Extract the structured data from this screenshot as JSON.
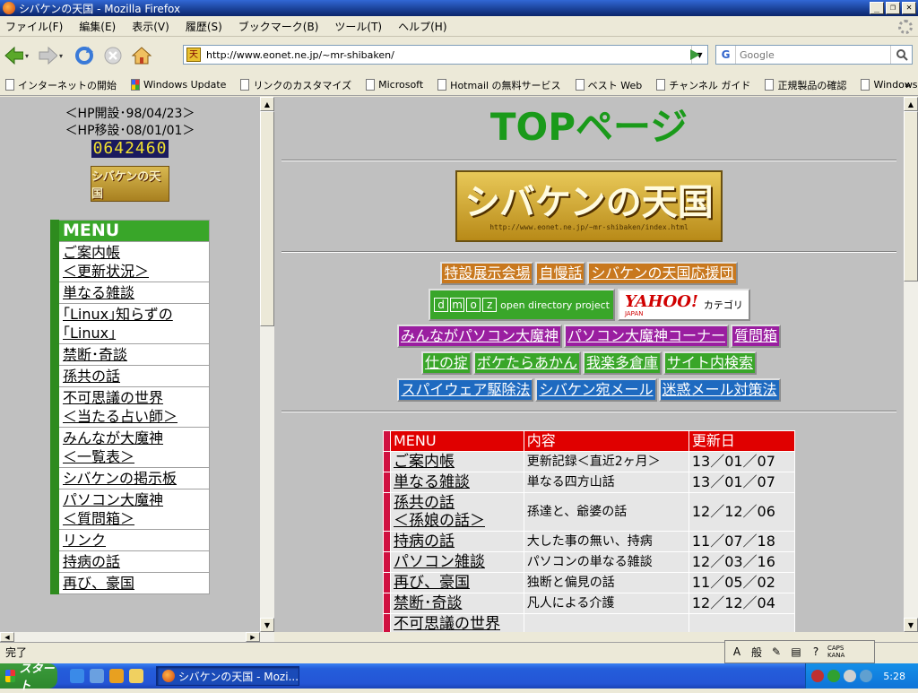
{
  "window": {
    "title": "シバケンの天国 - Mozilla Firefox"
  },
  "menubar": [
    "ファイル(F)",
    "編集(E)",
    "表示(V)",
    "履歴(S)",
    "ブックマーク(B)",
    "ツール(T)",
    "ヘルプ(H)"
  ],
  "nav": {
    "url": "http://www.eonet.ne.jp/~mr-shibaken/",
    "site_favicon": "天",
    "search_placeholder": "Google",
    "search_engine_icon": "G"
  },
  "bookmarks": [
    "インターネットの開始",
    "Windows Update",
    "リンクのカスタマイズ",
    "Microsoft",
    "Hotmail の無料サービス",
    "ベスト Web",
    "チャンネル ガイド",
    "正規製品の確認",
    "Windows"
  ],
  "bookmarks_more": "»",
  "left": {
    "hp_open": "＜HP開設･98/04/23＞",
    "hp_move": "＜HP移設･08/01/01＞",
    "counter": "0642460",
    "small_logo": "シバケンの天国",
    "menu_title": "MENU",
    "menu_items": [
      "ご案内帳\n＜更新状況＞",
      "単なる雑談",
      "｢Linux｣知らずの\n｢Linux｣",
      "禁断･奇談",
      "孫共の話",
      "不可思議の世界\n＜当たる占い師＞",
      "みんなが大魔神\n＜一覧表＞",
      "シバケンの掲示板",
      "パソコン大魔神\n＜質問箱＞",
      "リンク",
      "持病の話",
      "再び、豪国"
    ]
  },
  "main": {
    "title": "TOPページ",
    "banner_title": "シバケンの天国",
    "banner_url": "http://www.eonet.ne.jp/~mr-shibaken/index.html",
    "row1": [
      "特設展示会場",
      "自慢話",
      "シバケンの天国応援団"
    ],
    "dmoz": {
      "letters": [
        "d",
        "m",
        "o",
        "z"
      ],
      "text": "open directory project"
    },
    "yahoo": {
      "logo": "YAHOO!",
      "sub": "JAPAN",
      "cat": "カテゴリ"
    },
    "row3": [
      "みんながパソコン大魔神",
      "パソコン大魔神コーナー",
      "質問箱"
    ],
    "row4": [
      "仕の掟",
      "ボケたらあかん",
      "我楽多倉庫",
      "サイト内検索"
    ],
    "row5": [
      "スパイウェア駆除法",
      "シバケン宛メール",
      "迷惑メール対策法"
    ],
    "table": {
      "headers": [
        "MENU",
        "内容",
        "更新日"
      ],
      "rows": [
        {
          "menu": "ご案内帳",
          "content": "更新記録＜直近2ヶ月＞",
          "date": "13／01／07"
        },
        {
          "menu": "単なる雑談",
          "content": "単なる四方山話",
          "date": "13／01／07"
        },
        {
          "menu": "孫共の話\n＜孫娘の話＞",
          "content": "孫達と、爺婆の話",
          "date": "12／12／06"
        },
        {
          "menu": "持病の話",
          "content": "大した事の無い、持病",
          "date": "11／07／18"
        },
        {
          "menu": "パソコン雑談",
          "content": "パソコンの単なる雑談",
          "date": "12／03／16"
        },
        {
          "menu": "再び、豪国",
          "content": "独断と偏見の話",
          "date": "11／05／02"
        },
        {
          "menu": "禁断･奇談",
          "content": "凡人による介護",
          "date": "12／12／04"
        },
        {
          "menu": "不可思議の世界",
          "content": "",
          "date": ""
        }
      ]
    }
  },
  "status": {
    "text": "完了",
    "ime_mode": "般",
    "caps": "CAPS",
    "kana": "KANA"
  },
  "taskbar": {
    "start": "スタート",
    "task_label": "シバケンの天国 - Mozi...",
    "clock": "5:28"
  },
  "colors": {
    "accent_green": "#39a629",
    "title_green": "#1a9a1a",
    "table_red": "#e00000"
  }
}
